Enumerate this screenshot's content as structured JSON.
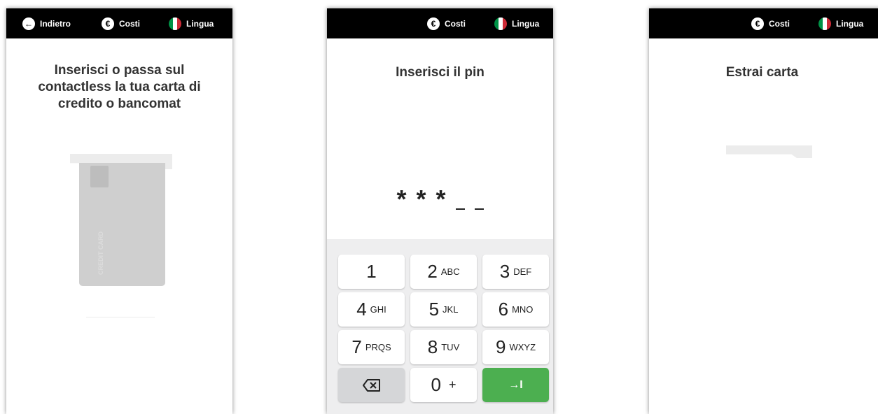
{
  "screens": {
    "card_insert": {
      "topbar": {
        "back_label": "Indietro",
        "costs_label": "Costi",
        "language_label": "Lingua"
      },
      "title": "Inserisci o passa sul contactless la tua carta di credito o bancomat",
      "card_text": "CREDIT CARD"
    },
    "pin_entry": {
      "topbar": {
        "costs_label": "Costi",
        "language_label": "Lingua"
      },
      "title": "Inserisci il pin",
      "pin_entered": 3,
      "pin_length": 5,
      "keys": [
        {
          "num": "1",
          "letters": ""
        },
        {
          "num": "2",
          "letters": "ABC"
        },
        {
          "num": "3",
          "letters": "DEF"
        },
        {
          "num": "4",
          "letters": "GHI"
        },
        {
          "num": "5",
          "letters": "JKL"
        },
        {
          "num": "6",
          "letters": "MNO"
        },
        {
          "num": "7",
          "letters": "PRQS"
        },
        {
          "num": "8",
          "letters": "TUV"
        },
        {
          "num": "9",
          "letters": "WXYZ"
        }
      ],
      "zero_key": {
        "num": "0",
        "letters": "+"
      },
      "backspace_icon": "backspace-icon",
      "enter_icon": "tab-enter-icon",
      "enter_symbol": "→I"
    },
    "card_remove": {
      "topbar": {
        "costs_label": "Costi",
        "language_label": "Lingua"
      },
      "title": "Estrai carta"
    }
  },
  "colors": {
    "topbar": "#000000",
    "enter_key": "#4caf50",
    "keypad_bg": "#eeeeef",
    "flag": [
      "#009246",
      "#ffffff",
      "#ce2b37"
    ]
  },
  "currency_symbol": "€",
  "back_arrow": "←"
}
